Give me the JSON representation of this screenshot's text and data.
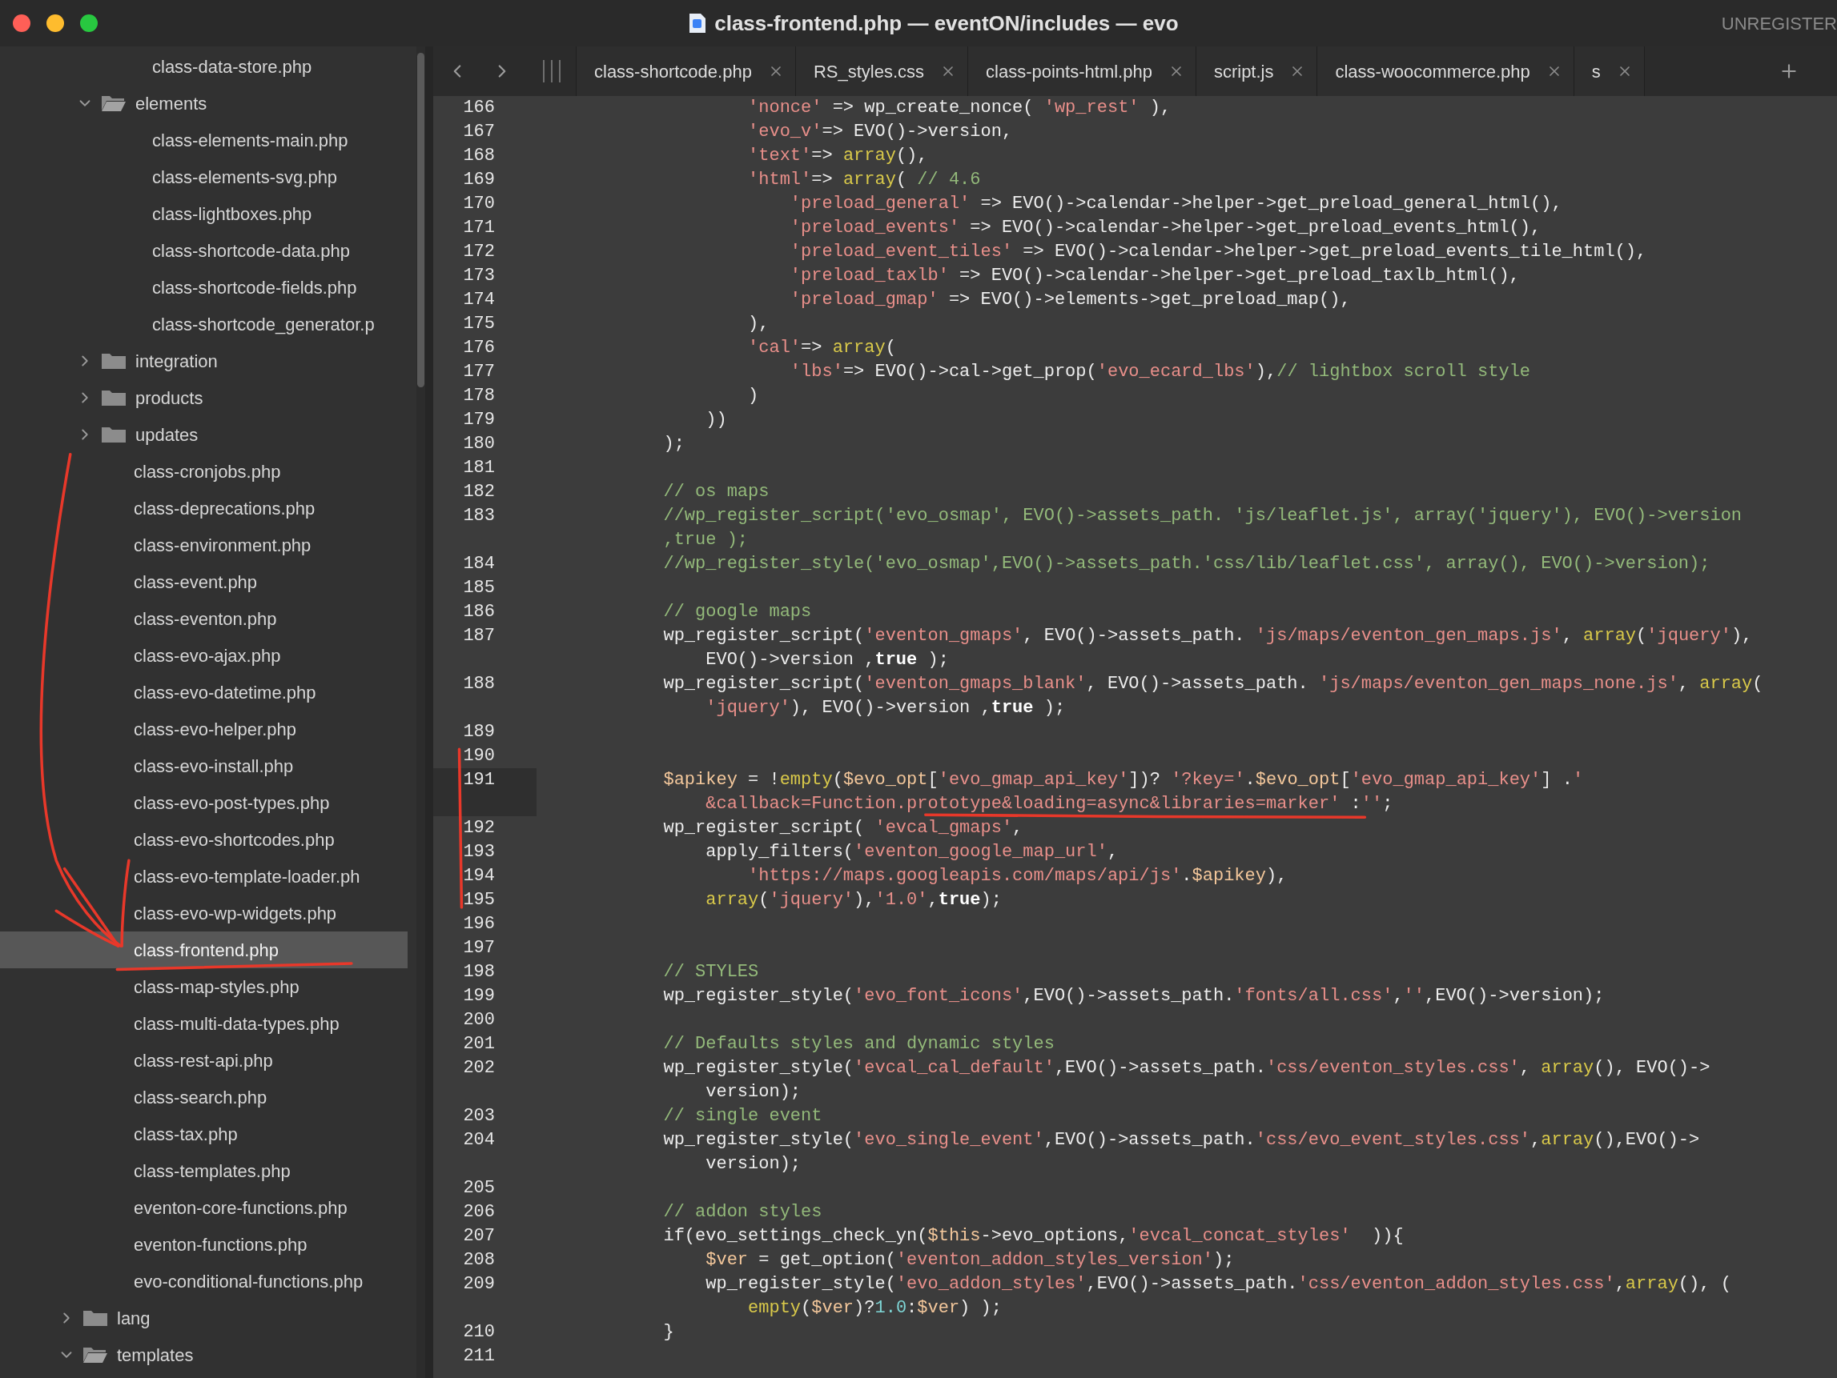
{
  "window": {
    "title": "class-frontend.php — eventON/includes — evo",
    "badge": "UNREGISTER"
  },
  "sidebar": {
    "tree": [
      {
        "kind": "folder",
        "children": [
          {
            "kind": "folder",
            "children": [
              {
                "kind": "file",
                "name": "class-data-store.php",
                "selected": false
              }
            ]
          },
          {
            "kind": "folder",
            "name": "elements",
            "expanded": true,
            "children": [
              {
                "kind": "file",
                "name": "class-elements-main.php",
                "selected": false
              },
              {
                "kind": "file",
                "name": "class-elements-svg.php",
                "selected": false
              },
              {
                "kind": "file",
                "name": "class-lightboxes.php",
                "selected": false
              },
              {
                "kind": "file",
                "name": "class-shortcode-data.php",
                "selected": false
              },
              {
                "kind": "file",
                "name": "class-shortcode-fields.php",
                "selected": false
              },
              {
                "kind": "file",
                "name": "class-shortcode_generator.p",
                "selected": false
              }
            ]
          },
          {
            "kind": "folder",
            "name": "integration",
            "expanded": false
          },
          {
            "kind": "folder",
            "name": "products",
            "expanded": false
          },
          {
            "kind": "folder",
            "name": "updates",
            "expanded": false
          },
          {
            "kind": "file",
            "name": "class-cronjobs.php",
            "selected": false
          },
          {
            "kind": "file",
            "name": "class-deprecations.php",
            "selected": false
          },
          {
            "kind": "file",
            "name": "class-environment.php",
            "selected": false
          },
          {
            "kind": "file",
            "name": "class-event.php",
            "selected": false
          },
          {
            "kind": "file",
            "name": "class-eventon.php",
            "selected": false
          },
          {
            "kind": "file",
            "name": "class-evo-ajax.php",
            "selected": false
          },
          {
            "kind": "file",
            "name": "class-evo-datetime.php",
            "selected": false
          },
          {
            "kind": "file",
            "name": "class-evo-helper.php",
            "selected": false
          },
          {
            "kind": "file",
            "name": "class-evo-install.php",
            "selected": false
          },
          {
            "kind": "file",
            "name": "class-evo-post-types.php",
            "selected": false
          },
          {
            "kind": "file",
            "name": "class-evo-shortcodes.php",
            "selected": false
          },
          {
            "kind": "file",
            "name": "class-evo-template-loader.ph",
            "selected": false
          },
          {
            "kind": "file",
            "name": "class-evo-wp-widgets.php",
            "selected": false
          },
          {
            "kind": "file",
            "name": "class-frontend.php",
            "selected": true
          },
          {
            "kind": "file",
            "name": "class-map-styles.php",
            "selected": false
          },
          {
            "kind": "file",
            "name": "class-multi-data-types.php",
            "selected": false
          },
          {
            "kind": "file",
            "name": "class-rest-api.php",
            "selected": false
          },
          {
            "kind": "file",
            "name": "class-search.php",
            "selected": false
          },
          {
            "kind": "file",
            "name": "class-tax.php",
            "selected": false
          },
          {
            "kind": "file",
            "name": "class-templates.php",
            "selected": false
          },
          {
            "kind": "file",
            "name": "eventon-core-functions.php",
            "selected": false
          },
          {
            "kind": "file",
            "name": "eventon-functions.php",
            "selected": false
          },
          {
            "kind": "file",
            "name": "evo-conditional-functions.php",
            "selected": false
          }
        ]
      },
      {
        "kind": "folder",
        "name": "lang",
        "expanded": false
      },
      {
        "kind": "folder",
        "name": "templates",
        "expanded": true
      }
    ]
  },
  "tabs": [
    {
      "label": "class-shortcode.php",
      "selected": false
    },
    {
      "label": "RS_styles.css",
      "selected": false
    },
    {
      "label": "class-points-html.php",
      "selected": false
    },
    {
      "label": "script.js",
      "selected": false
    },
    {
      "label": "class-woocommerce.php",
      "selected": false
    },
    {
      "label": "s",
      "selected": false
    }
  ],
  "lines": [
    {
      "number": "166",
      "current": false,
      "rows": [
        "                    'nonce' => wp_create_nonce( 'wp_rest' ),"
      ]
    },
    {
      "number": "167",
      "current": false,
      "rows": [
        "                    'evo_v'=> EVO()->version,"
      ]
    },
    {
      "number": "168",
      "current": false,
      "rows": [
        "                    'text'=> array(),"
      ]
    },
    {
      "number": "169",
      "current": false,
      "rows": [
        "                    'html'=> array( // 4.6"
      ]
    },
    {
      "number": "170",
      "current": false,
      "rows": [
        "                        'preload_general' => EVO()->calendar->helper->get_preload_general_html(),"
      ]
    },
    {
      "number": "171",
      "current": false,
      "rows": [
        "                        'preload_events' => EVO()->calendar->helper->get_preload_events_html(),"
      ]
    },
    {
      "number": "172",
      "current": false,
      "rows": [
        "                        'preload_event_tiles' => EVO()->calendar->helper->get_preload_events_tile_html(),"
      ]
    },
    {
      "number": "173",
      "current": false,
      "rows": [
        "                        'preload_taxlb' => EVO()->calendar->helper->get_preload_taxlb_html(),"
      ]
    },
    {
      "number": "174",
      "current": false,
      "rows": [
        "                        'preload_gmap' => EVO()->elements->get_preload_map(),"
      ]
    },
    {
      "number": "175",
      "current": false,
      "rows": [
        "                    ),"
      ]
    },
    {
      "number": "176",
      "current": false,
      "rows": [
        "                    'cal'=> array("
      ]
    },
    {
      "number": "177",
      "current": false,
      "rows": [
        "                        'lbs'=> EVO()->cal->get_prop('evo_ecard_lbs'),// lightbox scroll style"
      ]
    },
    {
      "number": "178",
      "current": false,
      "rows": [
        "                    )"
      ]
    },
    {
      "number": "179",
      "current": false,
      "rows": [
        "                ))"
      ]
    },
    {
      "number": "180",
      "current": false,
      "rows": [
        "            );"
      ]
    },
    {
      "number": "181",
      "current": false
    },
    {
      "number": "182",
      "current": false,
      "rows": [
        "            // os maps"
      ]
    },
    {
      "number": "183",
      "current": false,
      "rows": [
        "            //wp_register_script('evo_osmap', EVO()->assets_path. 'js/leaflet.js', array('jquery'), EVO()->version",
        "            ,true );"
      ]
    },
    {
      "number": "184",
      "current": false,
      "rows": [
        "            //wp_register_style('evo_osmap',EVO()->assets_path.'css/lib/leaflet.css', array(), EVO()->version);"
      ]
    },
    {
      "number": "185",
      "current": false
    },
    {
      "number": "186",
      "current": false,
      "rows": [
        "            // google maps"
      ]
    },
    {
      "number": "187",
      "current": false,
      "rows": [
        "            wp_register_script('eventon_gmaps', EVO()->assets_path. 'js/maps/eventon_gen_maps.js', array('jquery'),",
        "                EVO()->version ,true );"
      ]
    },
    {
      "number": "188",
      "current": false,
      "rows": [
        "            wp_register_script('eventon_gmaps_blank', EVO()->assets_path. 'js/maps/eventon_gen_maps_none.js', array(",
        "                'jquery'), EVO()->version ,true );"
      ]
    },
    {
      "number": "189",
      "current": false
    },
    {
      "number": "190",
      "current": false
    },
    {
      "number": "191",
      "current": true,
      "rows": [
        "            $apikey = !empty($evo_opt['evo_gmap_api_key'])? '?key='.$evo_opt['evo_gmap_api_key'] .'",
        "                &callback=Function.prototype&loading=async&libraries=marker' :'';"
      ]
    },
    {
      "number": "192",
      "current": false,
      "rows": [
        "            wp_register_script( 'evcal_gmaps',"
      ]
    },
    {
      "number": "193",
      "current": false,
      "rows": [
        "                apply_filters('eventon_google_map_url',"
      ]
    },
    {
      "number": "194",
      "current": false,
      "rows": [
        "                    'https://maps.googleapis.com/maps/api/js'.$apikey),"
      ]
    },
    {
      "number": "195",
      "current": false,
      "rows": [
        "                array('jquery'),'1.0',true);"
      ]
    },
    {
      "number": "196",
      "current": false
    },
    {
      "number": "197",
      "current": false
    },
    {
      "number": "198",
      "current": false,
      "rows": [
        "            // STYLES"
      ]
    },
    {
      "number": "199",
      "current": false,
      "rows": [
        "            wp_register_style('evo_font_icons',EVO()->assets_path.'fonts/all.css','',EVO()->version);"
      ]
    },
    {
      "number": "200",
      "current": false
    },
    {
      "number": "201",
      "current": false,
      "rows": [
        "            // Defaults styles and dynamic styles"
      ]
    },
    {
      "number": "202",
      "current": false,
      "rows": [
        "            wp_register_style('evcal_cal_default',EVO()->assets_path.'css/eventon_styles.css', array(), EVO()->",
        "                version);"
      ]
    },
    {
      "number": "203",
      "current": false,
      "rows": [
        "            // single event"
      ]
    },
    {
      "number": "204",
      "current": false,
      "rows": [
        "            wp_register_style('evo_single_event',EVO()->assets_path.'css/evo_event_styles.css',array(),EVO()->",
        "                version);"
      ]
    },
    {
      "number": "205",
      "current": false
    },
    {
      "number": "206",
      "current": false,
      "rows": [
        "            // addon styles"
      ]
    },
    {
      "number": "207",
      "current": false,
      "rows": [
        "            if(evo_settings_check_yn($this->evo_options,'evcal_concat_styles'  )){"
      ]
    },
    {
      "number": "208",
      "current": false,
      "rows": [
        "                $ver = get_option('eventon_addon_styles_version');"
      ]
    },
    {
      "number": "209",
      "current": false,
      "rows": [
        "                wp_register_style('evo_addon_styles',EVO()->assets_path.'css/eventon_addon_styles.css',array(), (",
        "                    empty($ver)?1.0:$ver) );"
      ]
    },
    {
      "number": "210",
      "current": false,
      "rows": [
        "            }"
      ]
    },
    {
      "number": "211",
      "current": false
    }
  ]
}
